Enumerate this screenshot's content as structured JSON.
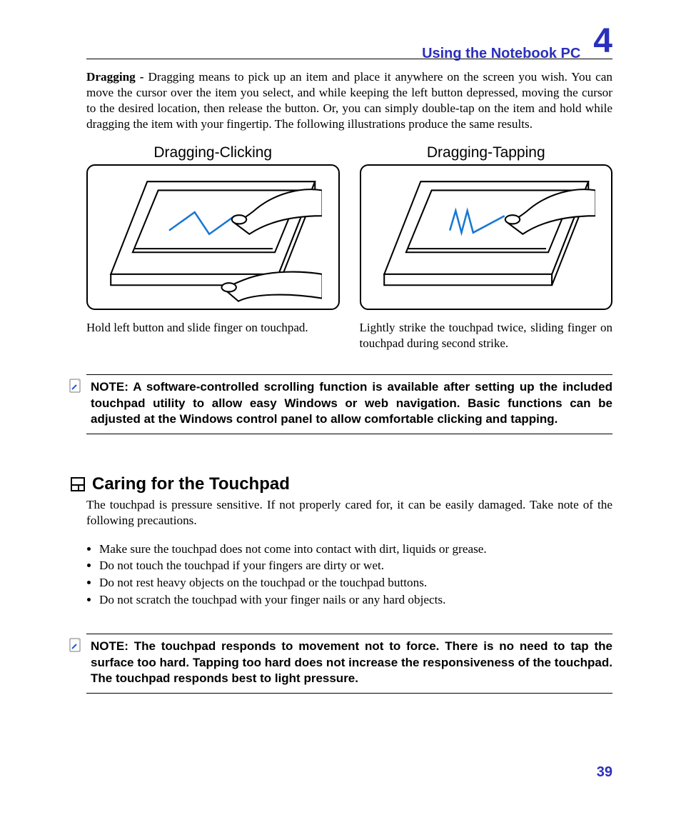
{
  "header": {
    "title": "Using the Notebook PC",
    "chapter": "4"
  },
  "dragging": {
    "label": "Dragging -",
    "text": " Dragging means to pick up an item and place it anywhere on the screen you wish. You can move the cursor over the item you select, and while keeping the left button depressed, moving the cursor to the desired location, then release the button. Or, you can simply double-tap on the item and hold while dragging the item with your fingertip. The following illustrations produce the same results."
  },
  "figs": {
    "left": {
      "title": "Dragging-Clicking",
      "caption": "Hold left button and slide finger on touchpad."
    },
    "right": {
      "title": "Dragging-Tapping",
      "caption": "Lightly strike the touchpad twice, sliding finger on touchpad during second strike."
    }
  },
  "note1": "NOTE: A software-controlled scrolling function is available after setting up the included touchpad utility to allow easy Windows or web navigation. Basic functions can be adjusted at the Windows control panel to allow comfortable clicking and tapping.",
  "section": {
    "heading": "Caring for the Touchpad",
    "intro": "The touchpad is pressure sensitive. If not properly cared for, it can be easily damaged. Take note of the following precautions.",
    "items": [
      "Make sure the touchpad does not come into contact with dirt, liquids or grease.",
      "Do not touch the touchpad if your fingers are dirty or wet.",
      "Do not rest heavy objects on the touchpad or the touchpad buttons.",
      "Do not scratch the touchpad with your finger nails or any hard objects."
    ]
  },
  "note2": "NOTE:  The touchpad responds to movement not to force. There is no need to tap the surface too hard. Tapping too hard does not increase the responsiveness of the touchpad. The touchpad responds best to light pressure.",
  "page_number": "39"
}
